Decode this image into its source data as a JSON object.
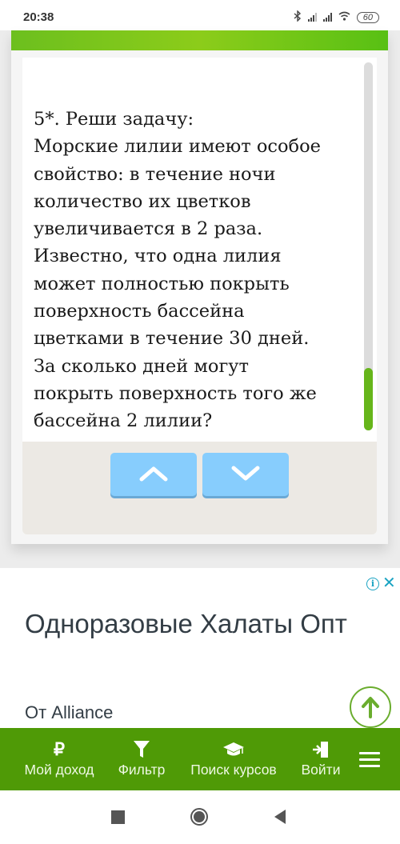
{
  "status_bar": {
    "time": "20:38",
    "battery": "60",
    "icons": [
      "bluetooth-icon",
      "signal-icon",
      "signal-icon",
      "wifi-icon",
      "battery-icon"
    ]
  },
  "task": {
    "lines": [
      "5*. Реши задачу:",
      "Морские лилии имеют особое",
      "свойство: в течение ночи",
      "количество их цветков",
      "увеличивается в 2 раза.",
      "Известно, что одна лилия",
      "может полностью покрыть",
      "поверхность бассейна",
      "цветками в течение 30 дней.",
      "За сколько дней могут",
      "покрыть поверхность того же",
      "бассейна 2 лилии?"
    ]
  },
  "navigation": {
    "up_icon": "chevron-up-icon",
    "down_icon": "chevron-down-icon"
  },
  "ad": {
    "title": "Одноразовые Халаты Опт",
    "source": "От Alliance",
    "info_glyph": "i",
    "close_glyph": "✕"
  },
  "bottom_nav": {
    "items": [
      {
        "label": "Мой доход",
        "icon": "ruble-icon",
        "glyph": "₽"
      },
      {
        "label": "Фильтр",
        "icon": "filter-icon"
      },
      {
        "label": "Поиск курсов",
        "icon": "graduation-cap-icon"
      },
      {
        "label": "Войти",
        "icon": "login-icon"
      }
    ],
    "menu_icon": "hamburger-menu-icon"
  },
  "colors": {
    "brand_green": "#4f9a06",
    "header_green": "#7cc51c",
    "nav_button_blue": "#87cdfd",
    "ad_accent": "#1aa3c2"
  }
}
